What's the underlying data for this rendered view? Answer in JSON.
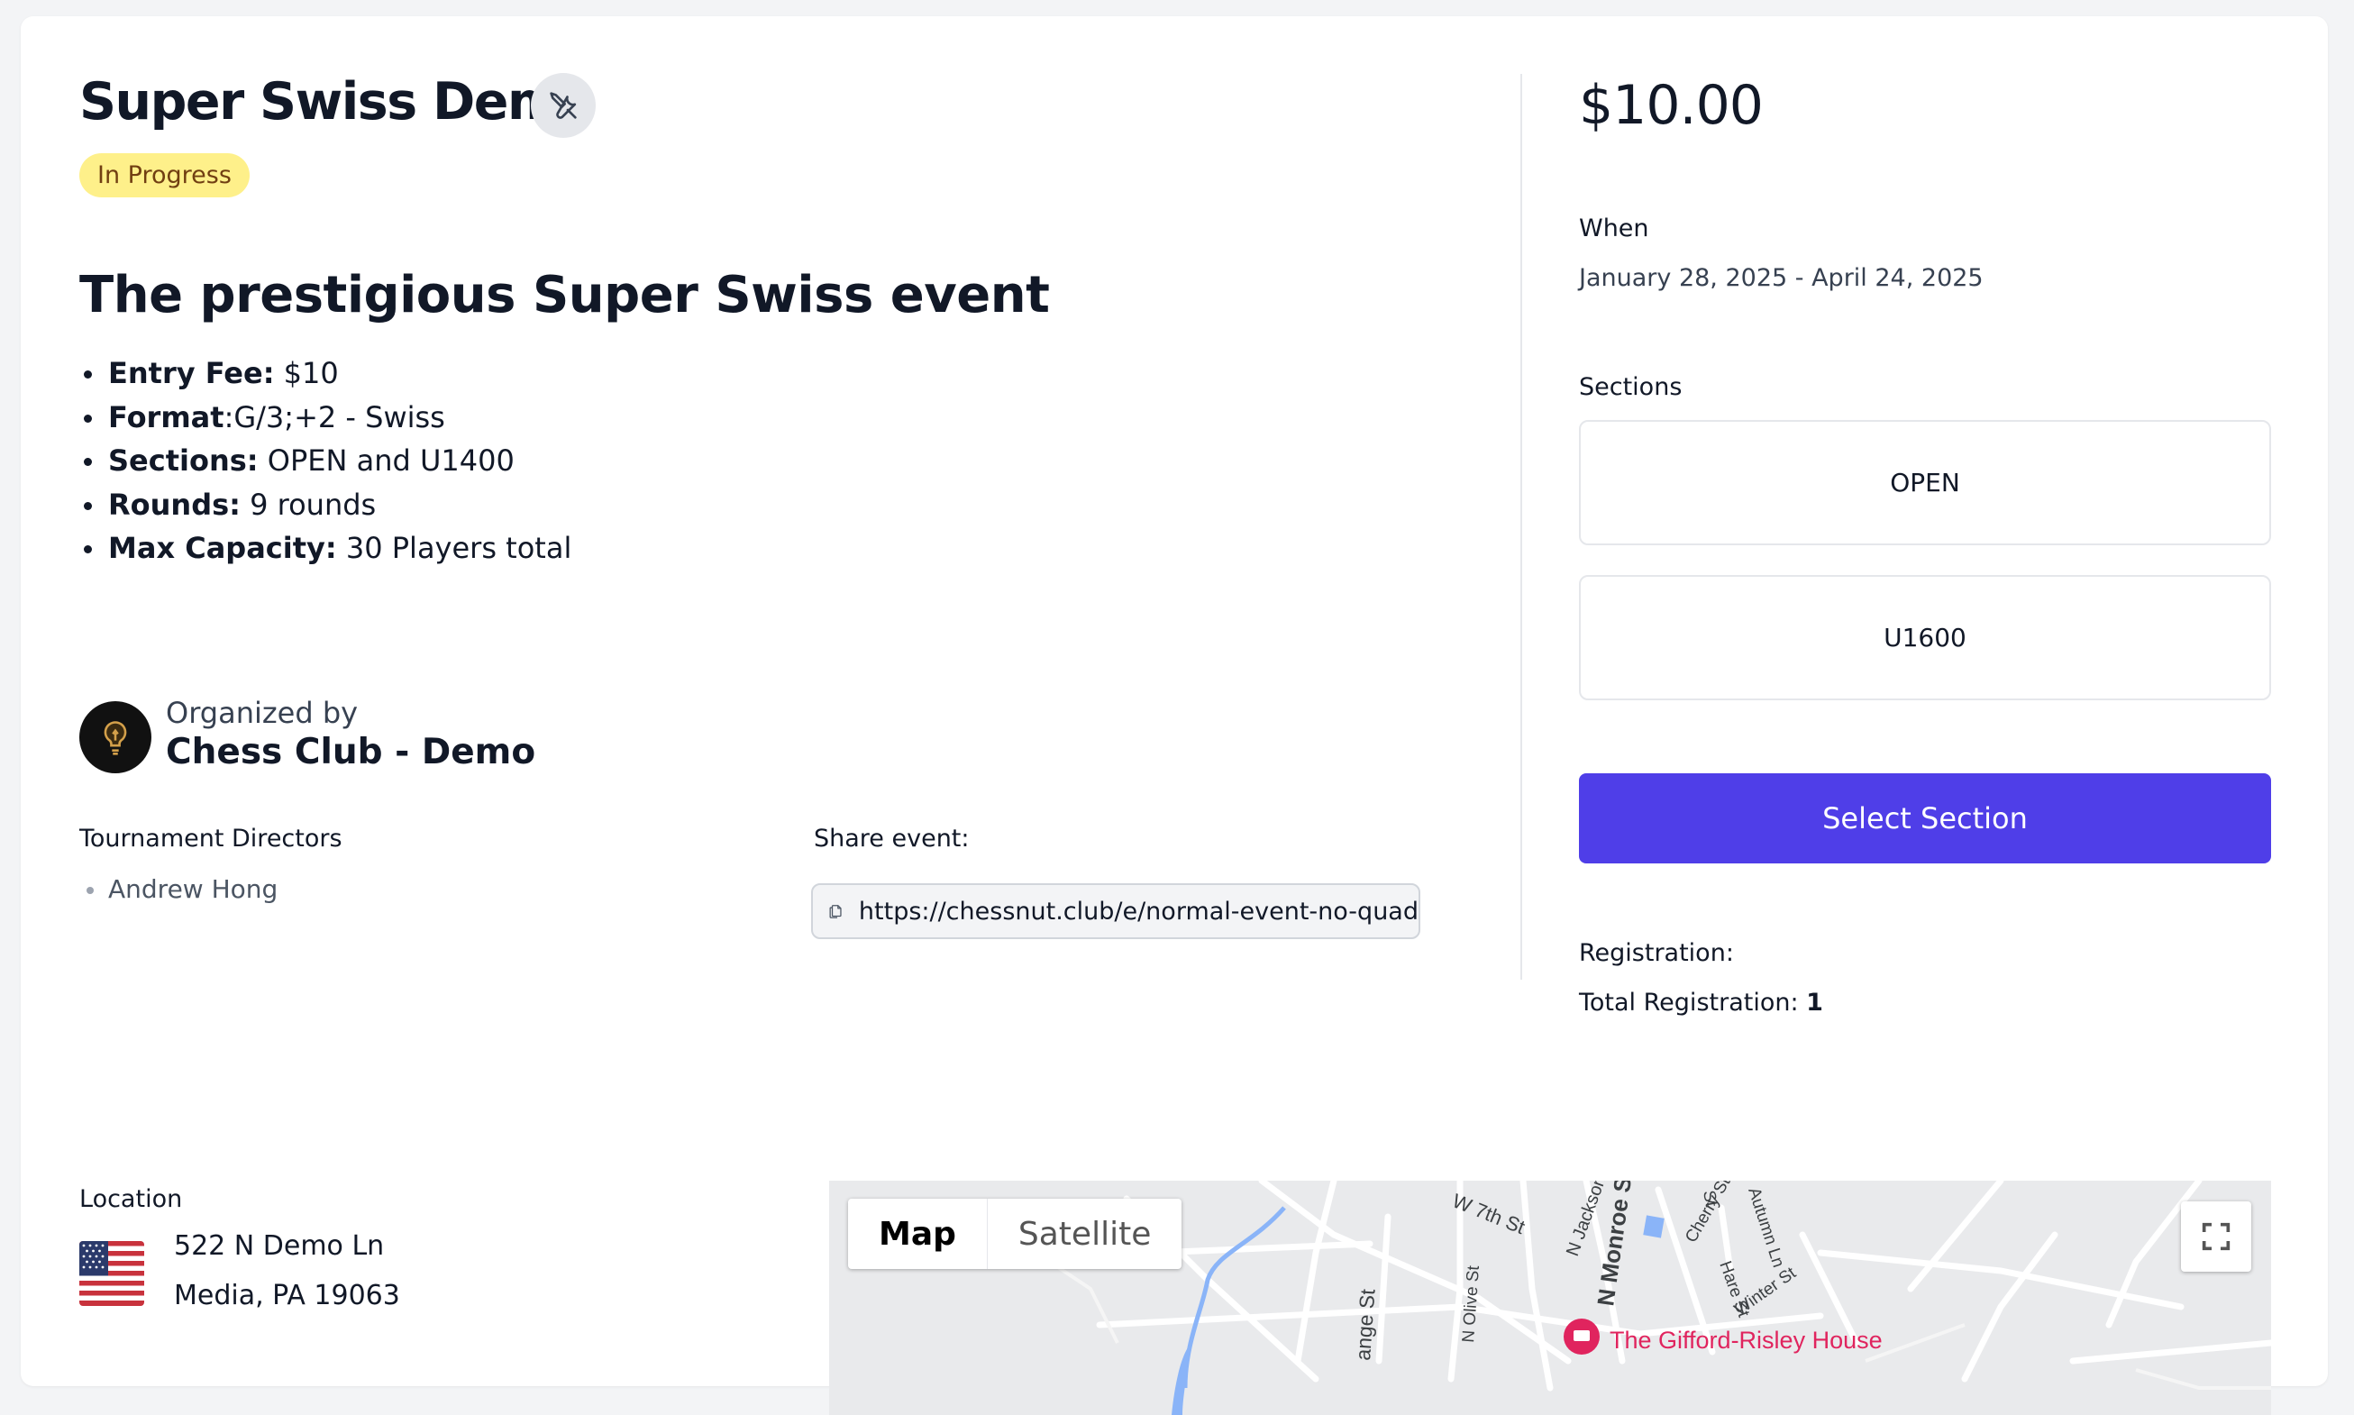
{
  "event": {
    "title": "Super Swiss Demo",
    "status": "In Progress",
    "headline": "The prestigious Super Swiss event",
    "details": [
      {
        "label": "Entry Fee:",
        "value": " $10"
      },
      {
        "label": "Format",
        "value": ":G/3;+2 - Swiss"
      },
      {
        "label": "Sections:",
        "value": " OPEN and U1400"
      },
      {
        "label": "Rounds:",
        "value": " 9 rounds"
      },
      {
        "label": "Max Capacity:",
        "value": " 30 Players total"
      }
    ]
  },
  "organizer": {
    "by_label": "Organized by",
    "name": "Chess Club - Demo"
  },
  "directors": {
    "label": "Tournament Directors",
    "items": [
      "Andrew Hong"
    ]
  },
  "share": {
    "label": "Share event:",
    "url": "https://chessnut.club/e/normal-event-no-quad"
  },
  "sidebar": {
    "price": "$10.00",
    "when_label": "When",
    "when_value": "January 28, 2025 - April 24, 2025",
    "sections_label": "Sections",
    "sections": [
      "OPEN",
      "U1600"
    ],
    "select_button": "Select Section",
    "registration_label": "Registration:",
    "total_registration_label": "Total Registration:",
    "total_registration_value": "1"
  },
  "location": {
    "label": "Location",
    "address_line1": "522 N Demo Ln",
    "address_line2": "Media, PA 19063",
    "flag": "us-flag"
  },
  "map": {
    "tabs": [
      "Map",
      "Satellite"
    ],
    "active_tab": "Map",
    "labels": {
      "w7th": "W 7th St",
      "njackson": "N Jackson",
      "nmonroe": "N Monroe St",
      "cherry": "Cherry St",
      "hare": "Hare St",
      "autumn": "Autumn Ln",
      "winter": "Winter St",
      "nolive": "N Olive St",
      "orange": "ange St",
      "st": "St",
      "poi": "The Gifford-Risley House"
    }
  },
  "colors": {
    "accent": "#4f3ee8",
    "badge_bg": "#fef08a",
    "badge_text": "#713f12",
    "poi": "#e0245e"
  }
}
